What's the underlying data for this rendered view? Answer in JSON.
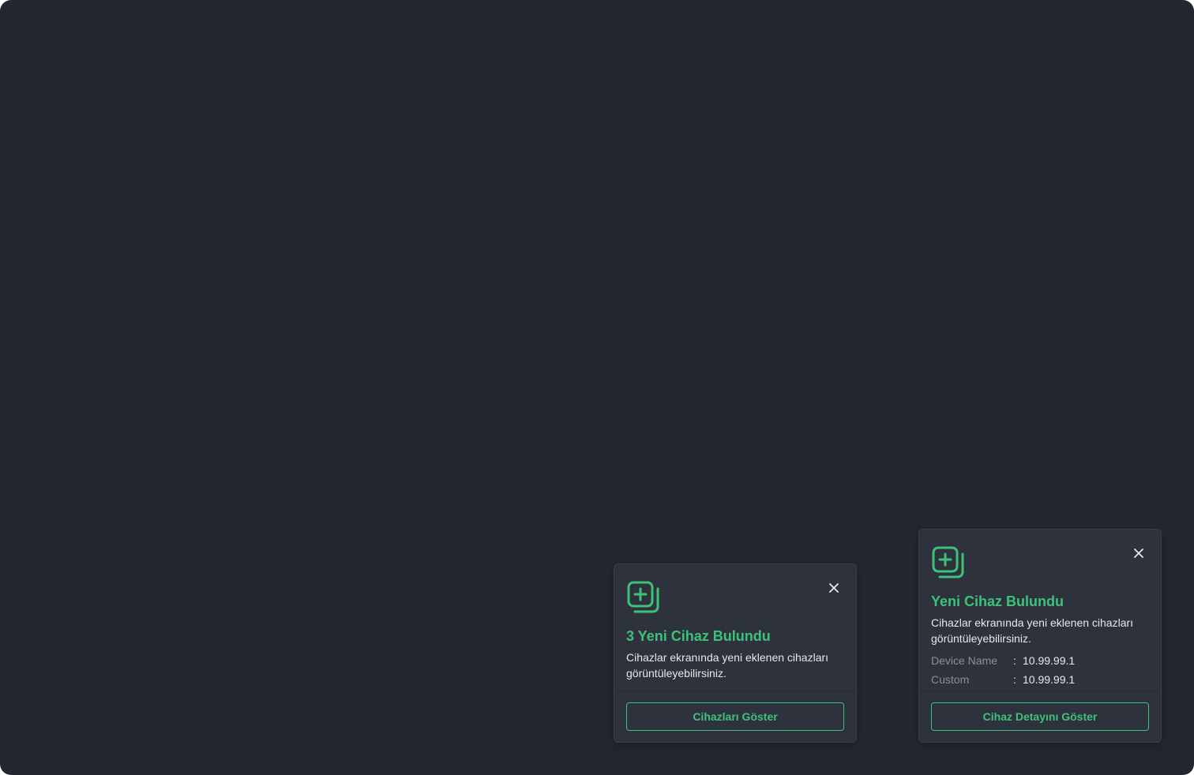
{
  "colors": {
    "background": "#23272f",
    "card": "#2d323c",
    "accent": "#3ec27a",
    "text": "#e6e8ec",
    "muted": "#8a909b"
  },
  "toasts": [
    {
      "icon": "add-stack-icon",
      "title": "3 Yeni Cihaz Bulundu",
      "description": "Cihazlar ekranında yeni eklenen cihazları görüntüleyebilirsiniz.",
      "button_label": "Cihazları Göster",
      "close_icon": "close-icon"
    },
    {
      "icon": "add-stack-icon",
      "title": "Yeni Cihaz Bulundu",
      "description": "Cihazlar ekranında yeni eklenen cihazları görüntüleyebilirsiniz.",
      "details": [
        {
          "label": "Device Name",
          "separator": ":",
          "value": "10.99.99.1"
        },
        {
          "label": "Custom",
          "separator": ":",
          "value": "10.99.99.1"
        }
      ],
      "button_label": "Cihaz Detayını Göster",
      "close_icon": "close-icon"
    }
  ]
}
